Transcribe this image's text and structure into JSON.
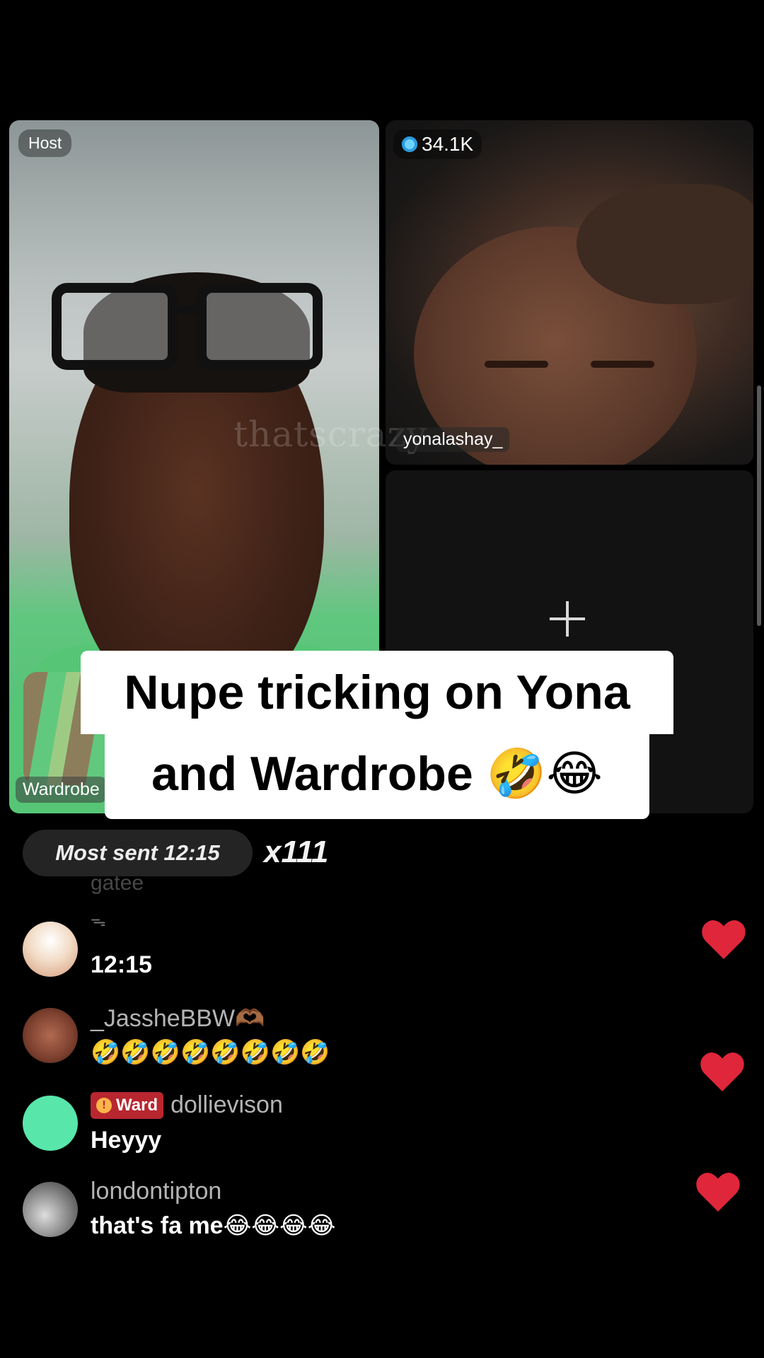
{
  "stream": {
    "host_badge": "Host",
    "host_name": "Wardrobe",
    "viewer_count": "34.1K",
    "guest_name": "yonalashay_",
    "watermark": "thatscrazy"
  },
  "caption": {
    "line1": "Nupe tricking on Yona",
    "line2": "and Wardrobe 🤣😂"
  },
  "gift_bar": {
    "label": "Most sent 12:15",
    "count": "x111"
  },
  "chat": {
    "faded_name": "gatee",
    "faded_icon": "ᯓ",
    "messages": [
      {
        "username": "",
        "text": "12:15"
      },
      {
        "username": "_JassheBBW🫶🏾",
        "text": "🤣🤣🤣🤣🤣🤣🤣🤣"
      },
      {
        "badge": "Ward",
        "username": "dollievison",
        "text": "Heyyy"
      },
      {
        "username": "londontipton",
        "text": "that's fa me😂😂😂😂"
      }
    ]
  },
  "icons": {
    "heart_color": "#e0263a",
    "plus": "add-guest-icon",
    "viewer_icon": "diamond-icon"
  }
}
